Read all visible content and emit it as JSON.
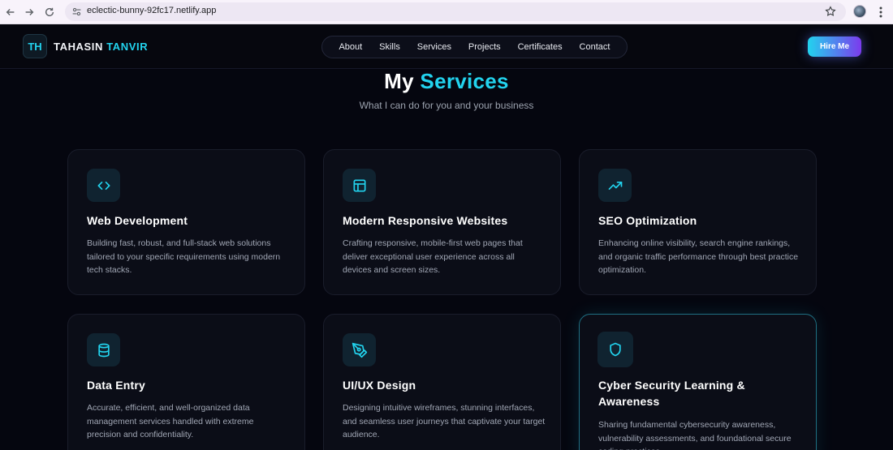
{
  "browser": {
    "url": "eclectic-bunny-92fc17.netlify.app"
  },
  "header": {
    "logo_initials": "TH",
    "name_first": "TAHASIN",
    "name_second": "TANVIR",
    "nav": [
      {
        "label": "About"
      },
      {
        "label": "Skills"
      },
      {
        "label": "Services"
      },
      {
        "label": "Projects"
      },
      {
        "label": "Certificates"
      },
      {
        "label": "Contact"
      }
    ],
    "cta_label": "Hire Me"
  },
  "section": {
    "title_plain": "My",
    "title_accent": "Services",
    "subtitle": "What I can do for you and your business"
  },
  "services": [
    {
      "title": "Web Development",
      "description": "Building fast, robust, and full-stack web solutions tailored to your specific requirements using modern tech stacks.",
      "icon": "code-icon"
    },
    {
      "title": "Modern Responsive Websites",
      "description": "Crafting responsive, mobile-first web pages that deliver exceptional user experience across all devices and screen sizes.",
      "icon": "layout-icon"
    },
    {
      "title": "SEO Optimization",
      "description": "Enhancing online visibility, search engine rankings, and organic traffic performance through best practice optimization.",
      "icon": "trending-up-icon"
    },
    {
      "title": "Data Entry",
      "description": "Accurate, efficient, and well-organized data management services handled with extreme precision and confidentiality.",
      "icon": "database-icon"
    },
    {
      "title": "UI/UX Design",
      "description": "Designing intuitive wireframes, stunning interfaces, and seamless user journeys that captivate your target audience.",
      "icon": "pen-tool-icon"
    },
    {
      "title": "Cyber Security Learning & Awareness",
      "description": "Sharing fundamental cybersecurity awareness, vulnerability assessments, and foundational secure coding practices.",
      "icon": "shield-icon"
    }
  ],
  "theme": {
    "accent": "#22d3ee",
    "background": "#05060f",
    "card_background": "#0b0d17"
  }
}
